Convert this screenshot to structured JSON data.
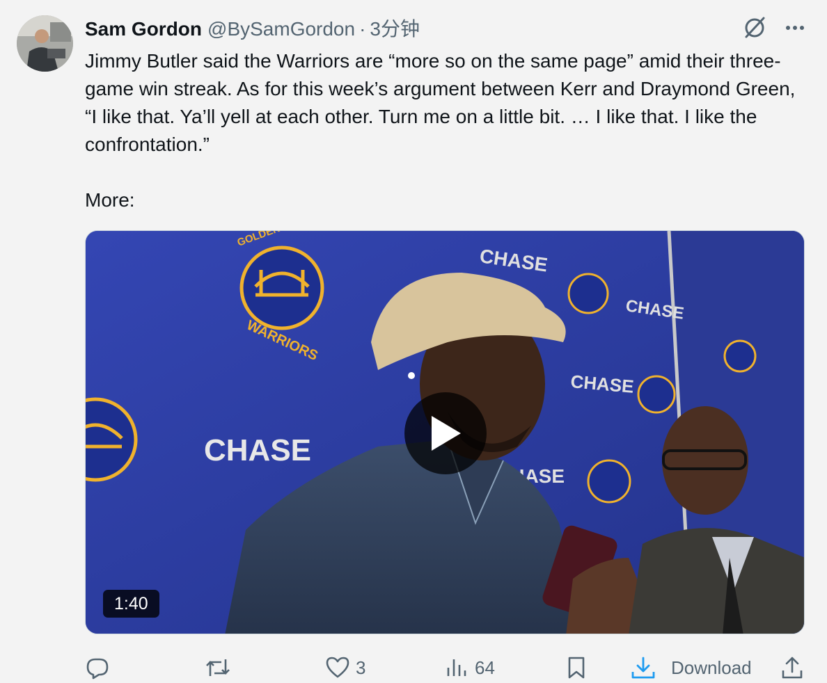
{
  "author": {
    "name": "Sam Gordon",
    "handle": "@BySamGordon",
    "separator": "·",
    "time": "3分钟"
  },
  "tweet": {
    "text": "Jimmy Butler said the Warriors are “more so on the same page” amid their three-game win streak. As for this week’s argument between Kerr and Draymond Green, “I like that. Ya’ll yell at each other. Turn me on a little bit. … I like that. I like the confrontation.”\n\nMore:"
  },
  "media": {
    "duration": "1:40",
    "backdrop_texts": {
      "golden_state": "GOLDEN STATE",
      "warriors": "WARRIORS",
      "chase": "CHASE"
    }
  },
  "actions": {
    "reply_count": "",
    "retweet_count": "",
    "like_count": "3",
    "view_count": "64",
    "download_label": "Download"
  },
  "icons": {
    "grok": "grok-icon",
    "more": "more-icon",
    "reply": "reply-icon",
    "retweet": "retweet-icon",
    "like": "heart-icon",
    "views": "views-icon",
    "bookmark": "bookmark-icon",
    "download": "download-icon",
    "share": "share-icon"
  },
  "colors": {
    "text": "#0f1419",
    "secondary": "#536471",
    "accent": "#1d9bf0",
    "backdrop_blue": "#2f41a8",
    "warriors_gold": "#f0b22d"
  }
}
